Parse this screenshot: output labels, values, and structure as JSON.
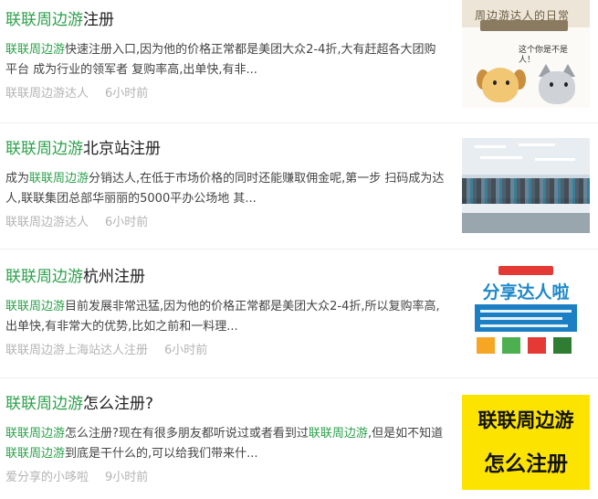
{
  "articles": [
    {
      "title_hl": "联联周边游",
      "title_rest": "注册",
      "desc_pre": "",
      "desc_hl": "联联周边游",
      "desc_rest": "快速注册入口,因为他的价格正常都是美团大众2-4折,大有赶超各大团购平台 成为行业的领军者 复购率高,出单快,有非...",
      "author": "联联周边游达人",
      "time": "6小时前",
      "thumb": {
        "headline": "周边游达人的日常",
        "bubble_line1": "这个你是不是",
        "bubble_line2": "人！"
      }
    },
    {
      "title_hl": "联联周边游",
      "title_rest": "北京站注册",
      "desc_pre": "成为",
      "desc_hl": "联联周边游",
      "desc_rest": "分销达人,在低于市场价格的同时还能赚取佣金呢,第一步 扫码成为达人,联联集团总部华丽丽的5000平办公场地 其...",
      "author": "联联周边游达人",
      "time": "6小时前"
    },
    {
      "title_hl": "联联周边游",
      "title_rest": "杭州注册",
      "desc_pre": "",
      "desc_hl": "联联周边游",
      "desc_rest": "目前发展非常迅猛,因为他的价格正常都是美团大众2-4折,所以复购率高,出单快,有非常大的优势,比如之前和一料理...",
      "author": "联联周边游上海站达人注册",
      "time": "6小时前",
      "thumb": {
        "headline": "分享达人啦"
      }
    },
    {
      "title_hl": "联联周边游",
      "title_rest": "怎么注册?",
      "desc_pre": "",
      "desc_hl": "联联周边游",
      "desc_mid": "怎么注册?现在有很多朋友都听说过或者看到过",
      "desc_hl2": "联联周边游",
      "desc_mid2": ",但是如不知道",
      "desc_hl3": "联联周边游",
      "desc_rest": "到底是干什么的,可以给我们带来什...",
      "author": "爱分享的小哆啦",
      "time": "9小时前",
      "thumb": {
        "line1": "联联周边游",
        "line2": "怎么注册"
      }
    }
  ],
  "colors": {
    "highlight": "#2c9f4b",
    "meta": "#b4b4b4",
    "thumb4_bg": "#fce300",
    "thumb3_accent": "#1e88c9"
  }
}
